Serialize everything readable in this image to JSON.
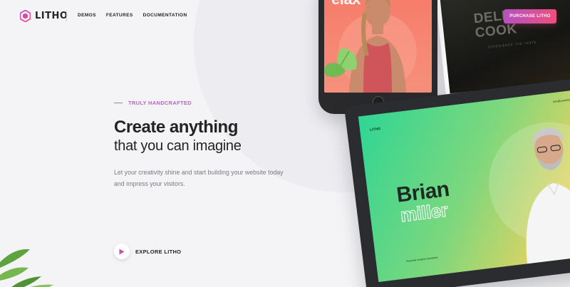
{
  "header": {
    "logo": "LITHO",
    "nav": [
      "DEMOS",
      "FEATURES",
      "DOCUMENTATION"
    ],
    "cta": "PURCHASE LITHO"
  },
  "hero": {
    "tagline": "TRULY HANDCRAFTED",
    "title": "Create anything",
    "subtitle": "that you can imagine",
    "description": "Let your creativity shine and start building your website today and impress your visitors.",
    "explore": "EXPLORE LITHO"
  },
  "mockups": {
    "phone_brand": "elax",
    "cook_title_1": "DELICI",
    "cook_title_2": "COOK",
    "cook_sub": "EXPERIENCE THE TASTE",
    "laptop_logo": "LITHO",
    "laptop_email": "info@yourdomain.com",
    "laptop_name_1": "Brian",
    "laptop_name_2": "miller",
    "laptop_foot": "Personal creative freelancer"
  },
  "colors": {
    "accent_start": "#b651c4",
    "accent_end": "#ee4f7b",
    "background": "#f4f4f7"
  },
  "icons": [
    "logo-icon",
    "play-icon",
    "leaf-icon"
  ]
}
